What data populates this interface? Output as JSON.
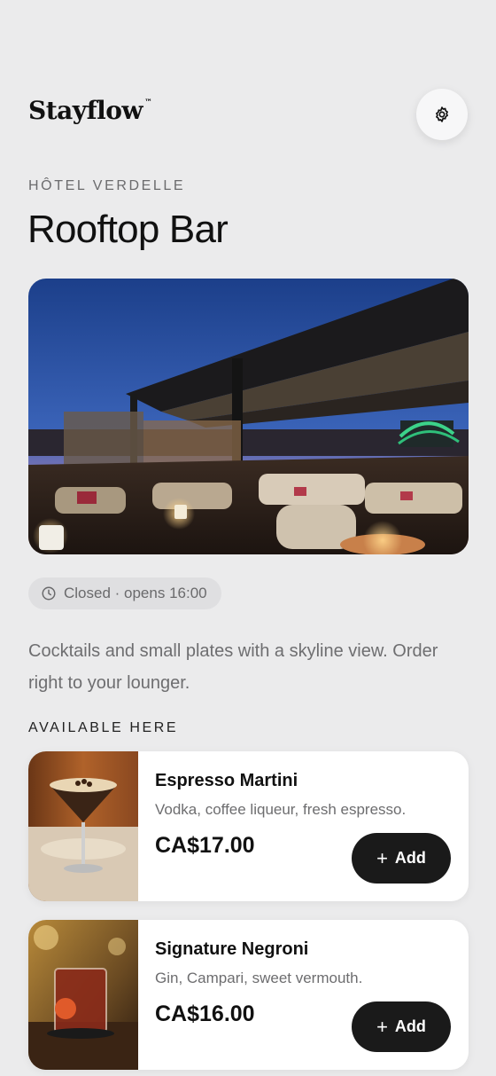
{
  "brand": {
    "name": "Stayflow",
    "trademark": "™"
  },
  "header": {
    "settings_icon": "gear-icon"
  },
  "venue": {
    "hotel": "HÔTEL VERDELLE",
    "title": "Rooftop Bar",
    "status": "Closed · opens 16:00",
    "status_icon": "clock-icon",
    "description": "Cocktails and small plates with a skyline view. Order right to your lounger."
  },
  "available": {
    "section_label": "AVAILABLE HERE",
    "items": [
      {
        "name": "Espresso Martini",
        "description": "Vodka, coffee liqueur, fresh espresso.",
        "price": "CA$17.00",
        "add_label": "Add"
      },
      {
        "name": "Signature Negroni",
        "description": "Gin, Campari, sweet vermouth.",
        "price": "CA$16.00",
        "add_label": "Add"
      }
    ]
  },
  "colors": {
    "background": "#ebebec",
    "button": "#1a1a1a",
    "card": "#ffffff",
    "pill": "#dfdfe1"
  }
}
